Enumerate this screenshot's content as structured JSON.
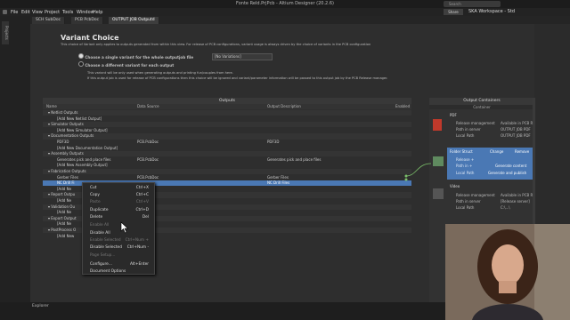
{
  "window": {
    "title": "Fonte Reld.PrjPcb - Altium Designer (20.2.6)"
  },
  "menu": [
    "File",
    "Edit",
    "View",
    "Project",
    "Tools",
    "Window",
    "Help"
  ],
  "search": {
    "placeholder": "Search"
  },
  "share": "Share",
  "workspace": "SKA Workspace - Std",
  "tabs": [
    "SCH SubDoc",
    "PCB PcbDoc",
    "OUTPUT JOB Outputd"
  ],
  "projects_label": "Projects",
  "variant": {
    "title": "Variant Choice",
    "desc": "This choice of Variant only applies to outputs generated from within this view. For release of PCB configurations, variant usage is always driven by the choice of variants in the PCB configuration",
    "opt1": "Choose a single variant for the whole outputjob file",
    "opt2": "Choose a different variant for each output",
    "select_value": "[No Variations]",
    "note1": "This variant will be only used when generating outputs and printing fun/couples from here.",
    "note2": "If this output job is used for release of PCB configurations then this choice will be ignored and variant/parameter information will be passed to this output job by the PCB Release manager."
  },
  "outputs": {
    "header": "Outputs",
    "columns": [
      "Name",
      "Data Source",
      "Output Description",
      "Enabled"
    ],
    "rows": [
      {
        "type": "sect",
        "name": "Netlist Outputs"
      },
      {
        "type": "item",
        "name": "[Add New Netlist Output]"
      },
      {
        "type": "sect",
        "name": "Simulator Outputs"
      },
      {
        "type": "item",
        "name": "[Add New Simulator Output]"
      },
      {
        "type": "sect",
        "name": "Documentation Outputs"
      },
      {
        "type": "item",
        "name": "PDF3D",
        "src": "PCB.PcbDoc",
        "desc": "PDF3D"
      },
      {
        "type": "item",
        "name": "[Add New Documentation Output]"
      },
      {
        "type": "sect",
        "name": "Assembly Outputs"
      },
      {
        "type": "item",
        "name": "Generates pick and place files",
        "src": "PCB.PcbDoc",
        "desc": "Generates pick and place files"
      },
      {
        "type": "item",
        "name": "[Add New Assembly Output]"
      },
      {
        "type": "sect",
        "name": "Fabrication Outputs"
      },
      {
        "type": "item",
        "name": "Gerber Files",
        "src": "PCB.PcbDoc",
        "desc": "Gerber Files"
      },
      {
        "type": "sel",
        "name": "NC Drill Fi",
        "src": "",
        "desc": "NC Drill Files"
      },
      {
        "type": "item",
        "name": "[Add Ne"
      },
      {
        "type": "sect",
        "name": "Report Outpu"
      },
      {
        "type": "item",
        "name": "[Add Ne"
      },
      {
        "type": "sect",
        "name": "Validation Ou"
      },
      {
        "type": "item",
        "name": "[Add Ne"
      },
      {
        "type": "sect",
        "name": "Export Output"
      },
      {
        "type": "item",
        "name": "[Add Ne"
      },
      {
        "type": "sect",
        "name": "PostProcess O"
      },
      {
        "type": "item",
        "name": "[Add New"
      }
    ]
  },
  "context_menu": [
    {
      "label": "Cut",
      "shortcut": "Ctrl+X",
      "enabled": true
    },
    {
      "label": "Copy",
      "shortcut": "Ctrl+C",
      "enabled": true
    },
    {
      "label": "Paste",
      "shortcut": "Ctrl+V",
      "enabled": false
    },
    {
      "label": "Duplicate",
      "shortcut": "Ctrl+D",
      "enabled": true
    },
    {
      "label": "Delete",
      "shortcut": "Del",
      "enabled": true
    },
    {
      "label": "Enable All",
      "shortcut": "",
      "enabled": false
    },
    {
      "label": "Disable All",
      "shortcut": "",
      "enabled": true
    },
    {
      "label": "Enable Selected",
      "shortcut": "Ctrl+Num +",
      "enabled": false
    },
    {
      "label": "Disable Selected",
      "shortcut": "Ctrl+Num -",
      "enabled": true
    },
    {
      "label": "Page Setup...",
      "shortcut": "",
      "enabled": false
    },
    {
      "label": "Configure...",
      "shortcut": "Alt+Enter",
      "enabled": true
    },
    {
      "label": "Document Options",
      "shortcut": "",
      "enabled": true
    }
  ],
  "containers": {
    "header": "Output Containers",
    "col": "Container",
    "pdf": {
      "title": "PDF",
      "rows": [
        [
          "Release management",
          "Available in PCB R"
        ],
        [
          "Path in server",
          "OUTPUT JOB PDF"
        ],
        [
          "Local Path",
          "OUTPUT JOB PDF"
        ]
      ]
    },
    "folder": {
      "title": "Folder Struct",
      "change": "Change",
      "remove": "Remove",
      "rows": [
        [
          "Release +",
          ""
        ],
        [
          "Path in +",
          "Generate content"
        ],
        [
          "Local Path",
          "Generate and publish"
        ]
      ]
    },
    "video": {
      "title": "Video",
      "rows": [
        [
          "Release management",
          "Available in PCB R"
        ],
        [
          "Path in server",
          "[Release server]"
        ],
        [
          "Local Path",
          "C:\\...\\"
        ]
      ]
    },
    "extra_lab": "Add",
    "print_lab": "Pr"
  },
  "bottom": {
    "explorer": "Explorer"
  },
  "colors": {
    "accent": "#4a78b4",
    "bg": "#2e2e2e"
  }
}
